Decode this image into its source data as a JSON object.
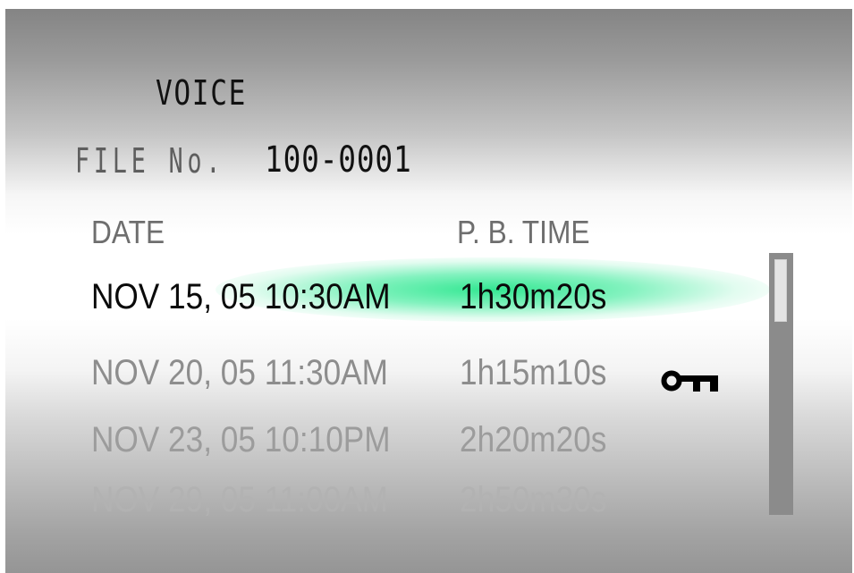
{
  "title": "VOICE",
  "file": {
    "label": "FILE No.",
    "number": "100-0001"
  },
  "columns": {
    "date": "DATE",
    "time": "P. B. TIME"
  },
  "recordings": [
    {
      "date": "NOV 15, 05 10:30AM",
      "time": "1h30m20s",
      "protected": false,
      "selected": true
    },
    {
      "date": "NOV 20, 05 11:30AM",
      "time": "1h15m10s",
      "protected": true,
      "selected": false
    },
    {
      "date": "NOV 23, 05 10:10PM",
      "time": "2h20m20s",
      "protected": false,
      "selected": false
    },
    {
      "date": "NOV 29, 05 11:00AM",
      "time": "2h50m30s",
      "protected": false,
      "selected": false
    }
  ],
  "icons": {
    "protect": "key-icon"
  },
  "colors": {
    "selection_highlight": "#28e68c",
    "scrollbar_track": "#8b8b8b",
    "scrollbar_thumb": "#e4e4e4"
  }
}
